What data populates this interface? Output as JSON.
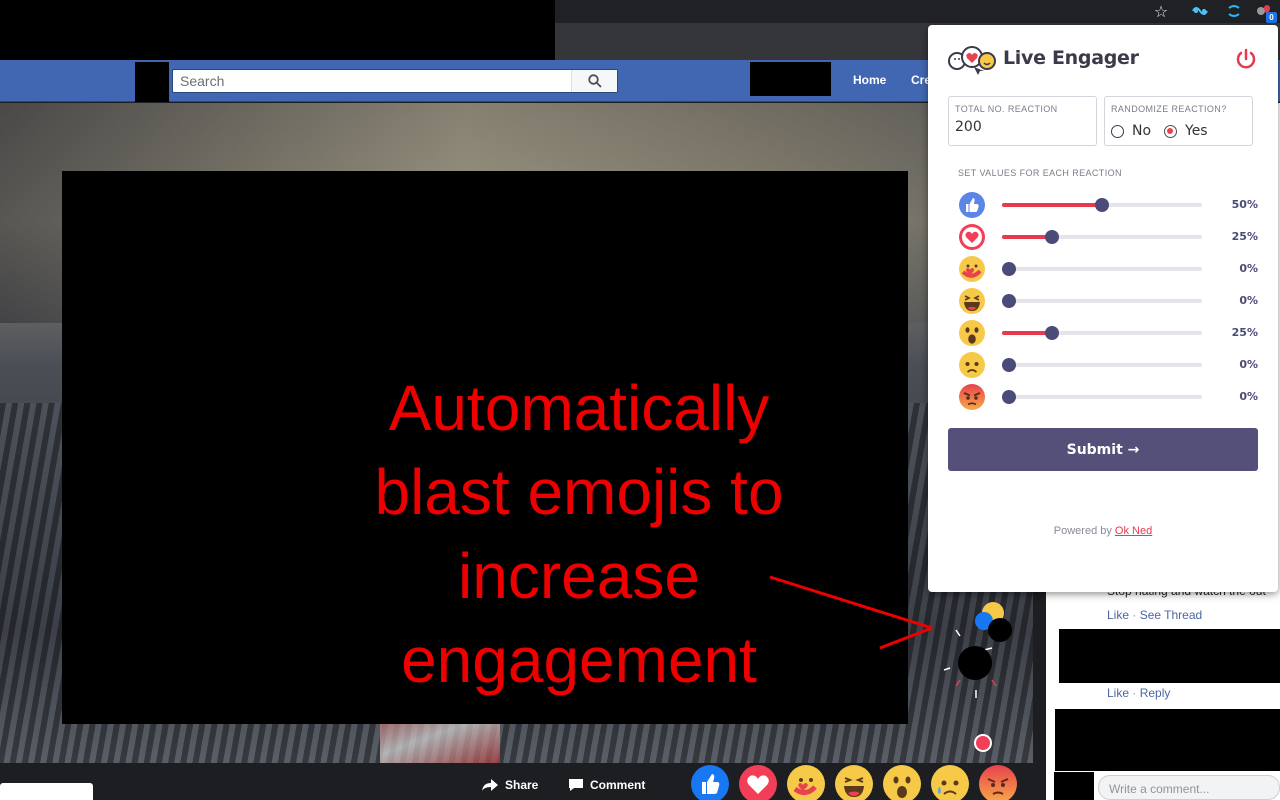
{
  "browser": {
    "star_icon": "star-icon",
    "extension_badge": "0"
  },
  "facebook": {
    "search": {
      "placeholder": "Search"
    },
    "nav": {
      "home": "Home",
      "create_partial": "Cre"
    }
  },
  "overlay": {
    "text": "Automatically blast emojis to increase engagement"
  },
  "actions": {
    "share": "Share",
    "comment": "Comment"
  },
  "comments": {
    "visible_text": "Stop hating and watch the out",
    "thread1": {
      "like": "Like",
      "see_thread": "See Thread"
    },
    "thread2": {
      "like": "Like",
      "reply": "Reply"
    },
    "write_placeholder": "Write a comment..."
  },
  "popup": {
    "title": "Live Engager",
    "total_label": "TOTAL NO. REACTION",
    "total_value": "200",
    "randomize_label": "RANDOMIZE REACTION?",
    "randomize_options": [
      "No",
      "Yes"
    ],
    "randomize_selected": "Yes",
    "section_label": "SET VALUES FOR EACH REACTION",
    "reactions": [
      {
        "name": "like",
        "percent_label": "50%",
        "value": 50
      },
      {
        "name": "love",
        "percent_label": "25%",
        "value": 25
      },
      {
        "name": "care",
        "percent_label": "0%",
        "value": 0
      },
      {
        "name": "haha",
        "percent_label": "0%",
        "value": 0
      },
      {
        "name": "wow",
        "percent_label": "25%",
        "value": 25
      },
      {
        "name": "sad",
        "percent_label": "0%",
        "value": 0
      },
      {
        "name": "angry",
        "percent_label": "0%",
        "value": 0
      }
    ],
    "submit_label": "Submit →",
    "powered_prefix": "Powered by",
    "powered_link": "Ok Ned"
  },
  "colors": {
    "accent": "#e63a4f",
    "slider_knob": "#4b4b7a",
    "submit": "#55507a",
    "fb_blue": "#4267b2",
    "overlay_text": "#ee0000"
  }
}
